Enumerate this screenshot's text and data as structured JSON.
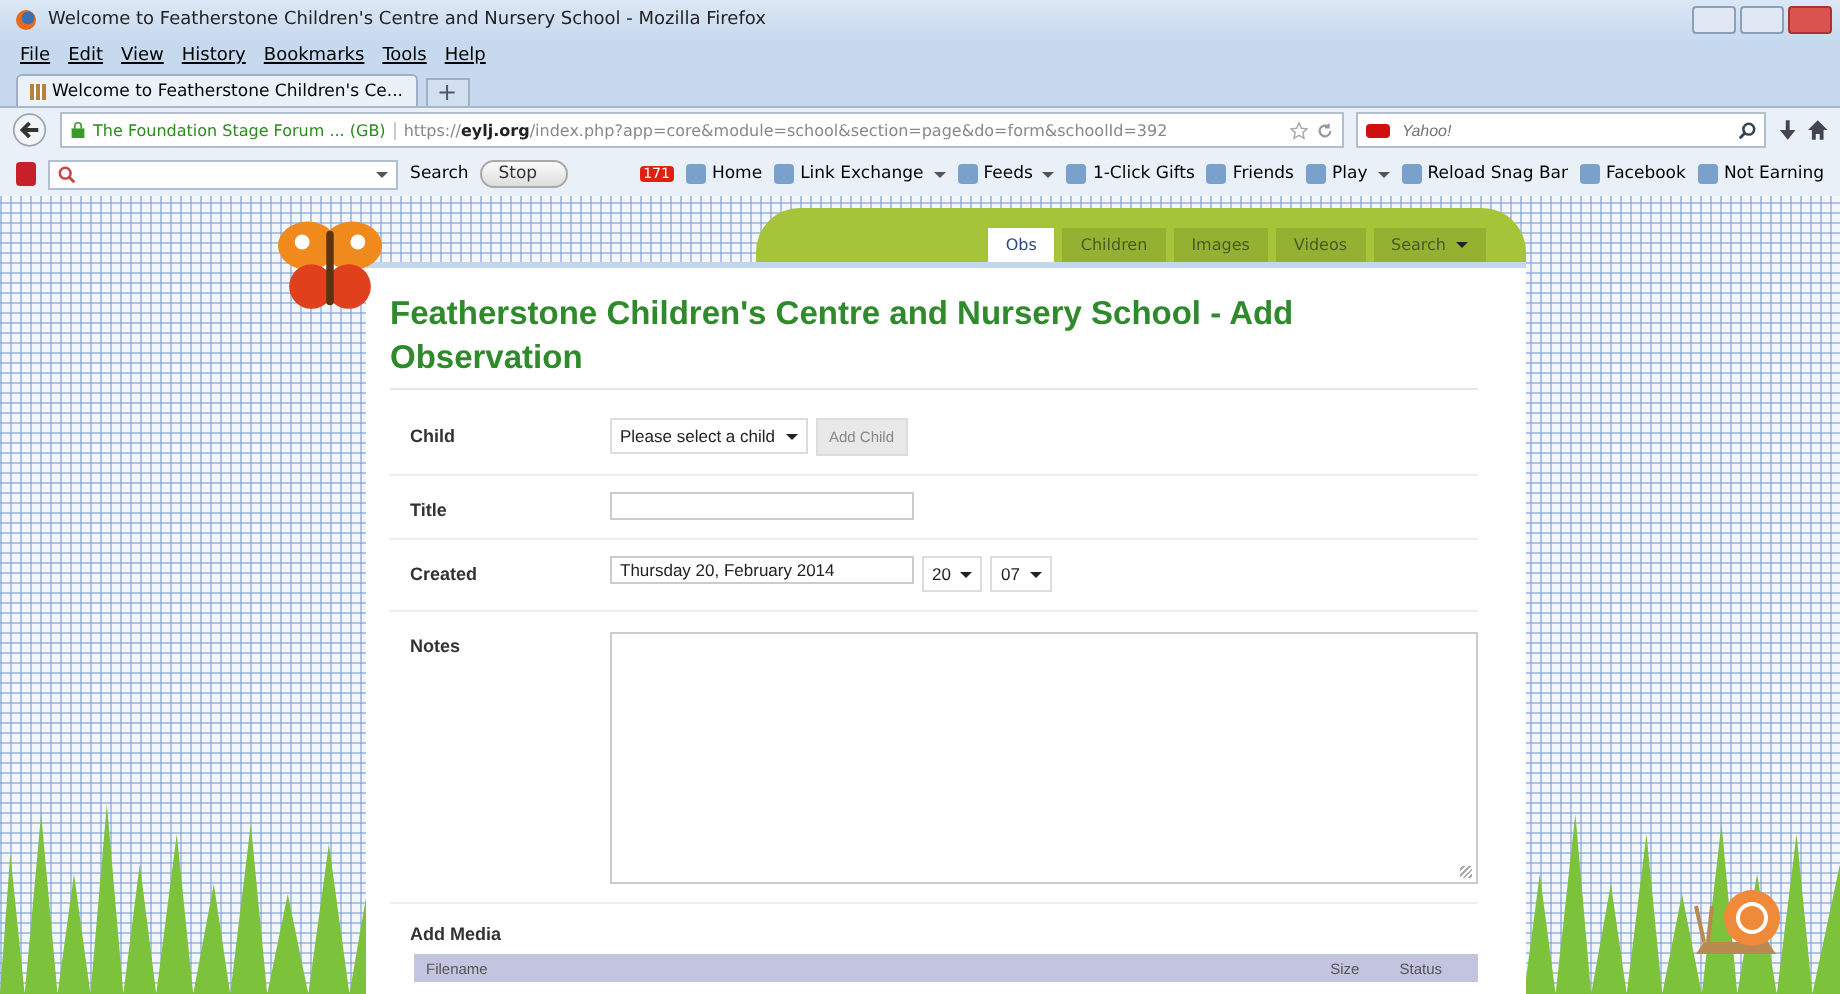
{
  "window": {
    "title": "Welcome to Featherstone Children's Centre and Nursery School - Mozilla Firefox"
  },
  "menu": [
    "File",
    "Edit",
    "View",
    "History",
    "Bookmarks",
    "Tools",
    "Help"
  ],
  "browser_tabs": [
    {
      "label": "Welcome to Featherstone Children's Ce...",
      "selected": true
    }
  ],
  "new_tab": "+",
  "address_bar": {
    "identity": "The Foundation Stage Forum ... (GB)",
    "url": "https://**eylj.org**/index.php?app=core&module=school&section=page&do=form&schoolId=392"
  },
  "search_bar": {
    "placeholder": "Yahoo!"
  },
  "toolbar": [
    {
      "kind": "search",
      "label": "Search"
    },
    {
      "kind": "button",
      "label": "Stop"
    },
    {
      "kind": "badge",
      "label": "171"
    },
    {
      "kind": "link",
      "label": "Home"
    },
    {
      "kind": "menu",
      "label": "Link Exchange"
    },
    {
      "kind": "menu",
      "label": "Feeds"
    },
    {
      "kind": "link",
      "label": "1-Click Gifts"
    },
    {
      "kind": "link",
      "label": "Friends"
    },
    {
      "kind": "menu",
      "label": "Play"
    },
    {
      "kind": "link",
      "label": "Reload Snag Bar"
    },
    {
      "kind": "link",
      "label": "Facebook"
    },
    {
      "kind": "link",
      "label": "Not Earning"
    }
  ],
  "site_nav": [
    {
      "label": "Obs",
      "selected": true,
      "dropdown": false
    },
    {
      "label": "Children",
      "selected": false,
      "dropdown": false
    },
    {
      "label": "Images",
      "selected": false,
      "dropdown": false
    },
    {
      "label": "Videos",
      "selected": false,
      "dropdown": false
    },
    {
      "label": "Search",
      "selected": false,
      "dropdown": true
    }
  ],
  "heading": "Featherstone Children's Centre and Nursery School - Add Observation",
  "form": [
    {
      "label": "Child",
      "controls": [
        {
          "kind": "select",
          "value": "Please select a child"
        },
        {
          "kind": "button",
          "value": "Add Child"
        }
      ]
    },
    {
      "label": "Title",
      "controls": [
        {
          "kind": "text"
        }
      ]
    },
    {
      "label": "Created",
      "controls": [
        {
          "kind": "text",
          "value": "Thursday 20, February 2014"
        },
        {
          "kind": "select",
          "value": "20"
        },
        {
          "kind": "select",
          "value": "07"
        }
      ]
    },
    {
      "label": "Notes",
      "controls": [
        {
          "kind": "textarea"
        }
      ]
    }
  ],
  "media": {
    "heading": "Add Media",
    "columns": [
      "Filename",
      "Size",
      "Status"
    ]
  }
}
